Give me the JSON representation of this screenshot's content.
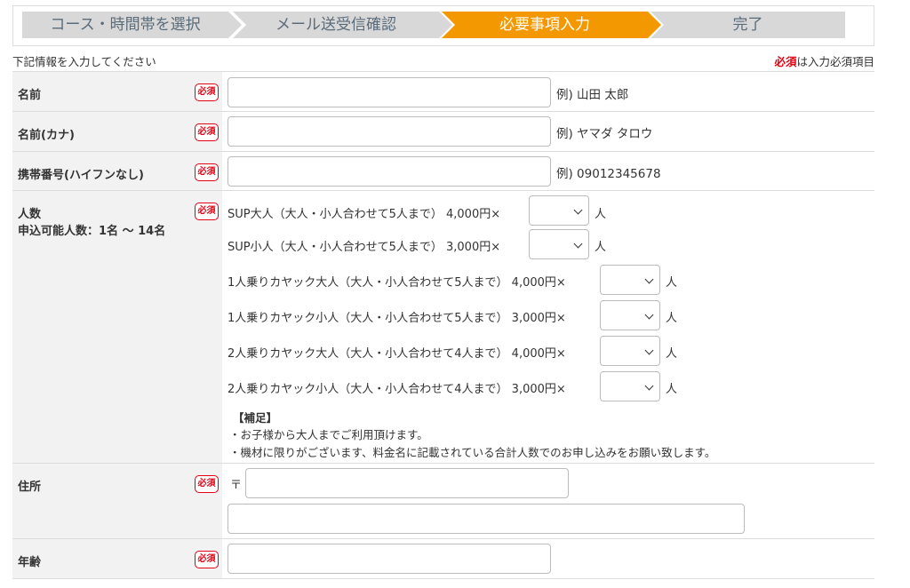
{
  "steps": [
    "コース・時間帯を選択",
    "メール送受信確認",
    "必要事項入力",
    "完了"
  ],
  "intro": "下記情報を入力してください",
  "legend": {
    "required_word": "必須",
    "rest": "は入力必須項目"
  },
  "badge": "必須",
  "fields": {
    "name": {
      "label": "名前",
      "example": "例) 山田 太郎",
      "value": ""
    },
    "kana": {
      "label": "名前(カナ)",
      "example": "例) ヤマダ タロウ",
      "value": ""
    },
    "phone": {
      "label": "携帯番号(ハイフンなし)",
      "example": "例) 09012345678",
      "value": ""
    },
    "people": {
      "label": "人数",
      "sublabel": "申込可能人数：1名 ～ 14名",
      "unit": "人",
      "options": [
        {
          "text": "SUP大人（大人・小人合わせて5人まで） 4,000円×",
          "selected": ""
        },
        {
          "text": "SUP小人（大人・小人合わせて5人まで） 3,000円×",
          "selected": ""
        },
        {
          "text": "1人乗りカヤック大人（大人・小人合わせて5人まで） 4,000円×",
          "selected": ""
        },
        {
          "text": "1人乗りカヤック小人（大人・小人合わせて5人まで） 3,000円×",
          "selected": ""
        },
        {
          "text": "2人乗りカヤック大人（大人・小人合わせて4人まで） 4,000円×",
          "selected": ""
        },
        {
          "text": "2人乗りカヤック小人（大人・小人合わせて4人まで） 3,000円×",
          "selected": ""
        }
      ],
      "notes": {
        "heading": "【補足】",
        "lines": [
          "・お子様から大人までご利用頂けます。",
          "・機材に限りがございます、料金名に記載されている合計人数でのお申し込みをお願い致します。"
        ]
      }
    },
    "address": {
      "label": "住所",
      "postal_mark": "〒",
      "postal_value": "",
      "address_value": ""
    },
    "age": {
      "label": "年齢",
      "value": ""
    }
  }
}
